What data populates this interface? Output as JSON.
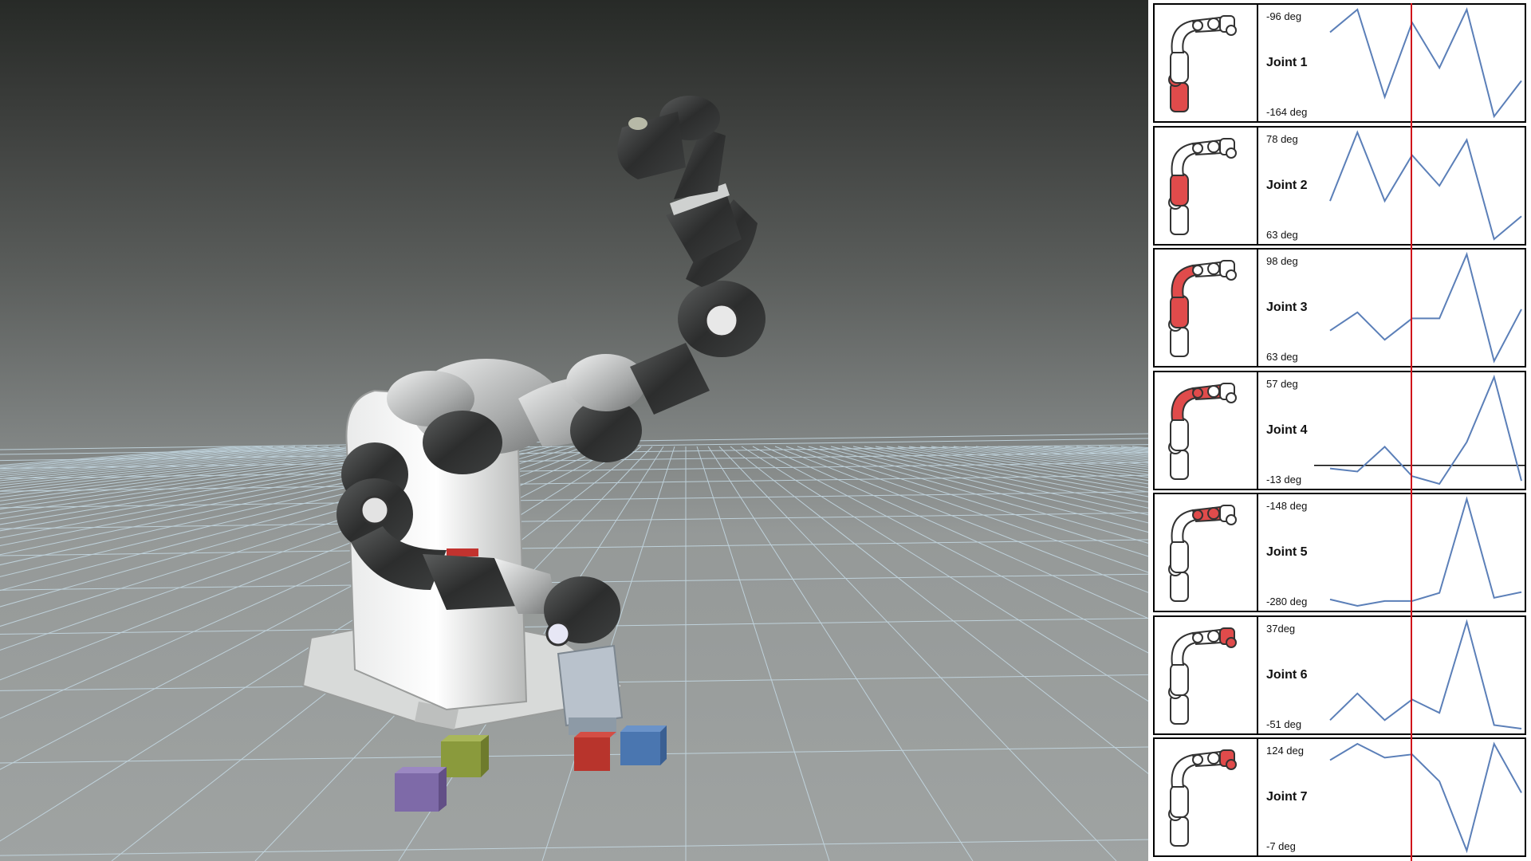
{
  "viewport": {
    "scene": "robot-arm-simulation",
    "cubes": [
      {
        "name": "green-cube",
        "color": "#8a9a3c"
      },
      {
        "name": "purple-cube",
        "color": "#7e6aa8"
      },
      {
        "name": "red-cube",
        "color": "#b8342c"
      },
      {
        "name": "blue-cube",
        "color": "#4a76b0"
      }
    ]
  },
  "colors": {
    "plot_line": "#5b7fb8",
    "time_cursor": "#d0121b",
    "highlight": "#e04b4b"
  },
  "joints": [
    {
      "label": "Joint 1",
      "max": "-96 deg",
      "min": "-164 deg",
      "values": [
        -110,
        -96,
        -150,
        -104,
        -132,
        -96,
        -162,
        -140
      ]
    },
    {
      "label": "Joint 2",
      "max": "78 deg",
      "min": "63 deg",
      "values": [
        69,
        78,
        69,
        75,
        71,
        77,
        64,
        67
      ]
    },
    {
      "label": "Joint 3",
      "max": "98 deg",
      "min": "63 deg",
      "values": [
        73,
        79,
        70,
        77,
        77,
        98,
        63,
        80
      ]
    },
    {
      "label": "Joint 4",
      "max": "57 deg",
      "min": "-13 deg",
      "values": [
        -2,
        -4,
        12,
        -7,
        -12,
        15,
        57,
        -10
      ],
      "zero_line": 0
    },
    {
      "label": "Joint 5",
      "max": "-148 deg",
      "min": "-280 deg",
      "values": [
        -272,
        -280,
        -274,
        -274,
        -264,
        -148,
        -270,
        -263
      ]
    },
    {
      "label": "Joint 6",
      "max": "37deg",
      "min": "-51 deg",
      "values": [
        -44,
        -22,
        -44,
        -27,
        -38,
        37,
        -48,
        -51
      ]
    },
    {
      "label": "Joint 7",
      "max": "124 deg",
      "min": "-7 deg",
      "values": [
        104,
        124,
        107,
        111,
        78,
        -7,
        124,
        64
      ]
    }
  ],
  "time_cursor_fraction": 0.43
}
